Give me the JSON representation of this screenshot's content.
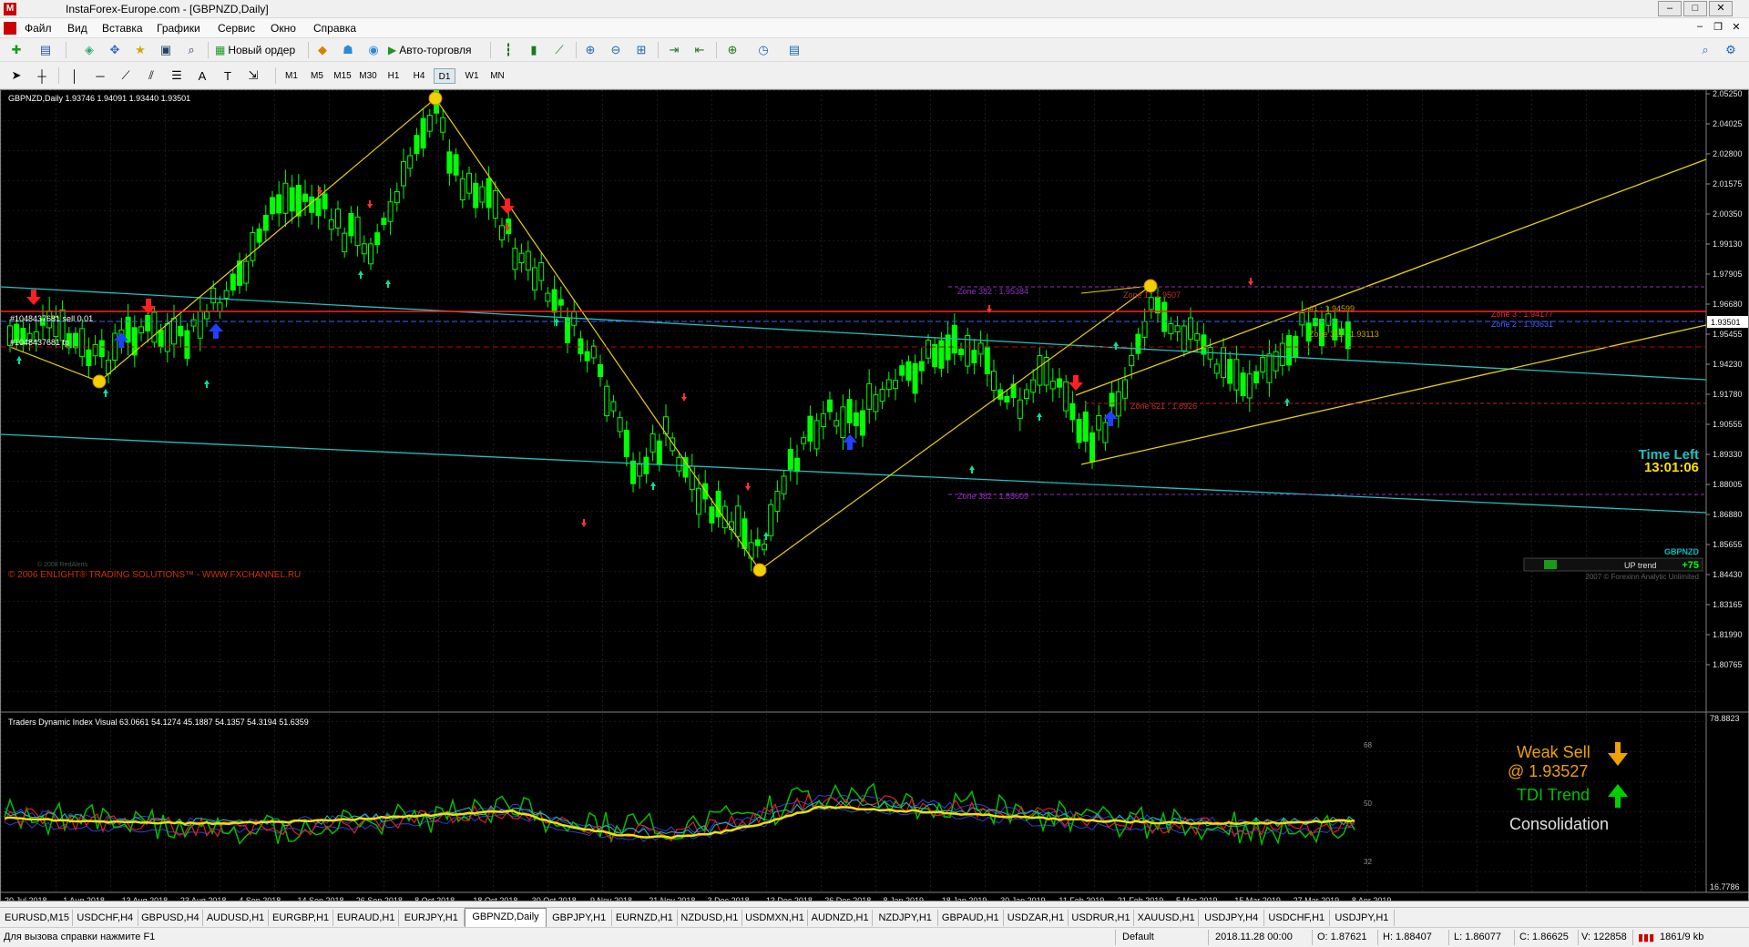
{
  "window": {
    "title": "InstaForex-Europe.com - [GBPNZD,Daily]",
    "app_icon": "metatrader-icon"
  },
  "menu": [
    "Файл",
    "Вид",
    "Вставка",
    "Графики",
    "Сервис",
    "Окно",
    "Справка"
  ],
  "toolbar": {
    "new_order": "Новый ордер",
    "auto_trading": "Авто-торговля"
  },
  "timeframes": [
    "M1",
    "M5",
    "M15",
    "M30",
    "H1",
    "H4",
    "D1",
    "W1",
    "MN"
  ],
  "active_timeframe": "D1",
  "chart": {
    "header": "GBPNZD,Daily  1.93746 1.94091 1.93440 1.93501",
    "price_scale": [
      "2.05250",
      "2.04025",
      "2.02800",
      "2.01575",
      "2.00350",
      "1.99130",
      "1.97905",
      "1.96680",
      "1.95455",
      "1.94230",
      "1.93501",
      "1.91780",
      "1.90555",
      "1.89330",
      "1.88005",
      "1.86880",
      "1.85655",
      "1.84430",
      "1.83165",
      "1.81990",
      "1.80765"
    ],
    "current_price": "1.93501",
    "date_scale": [
      "20 Jul 2018",
      "1 Aug 2018",
      "13 Aug 2018",
      "23 Aug 2018",
      "4 Sep 2018",
      "14 Sep 2018",
      "26 Sep 2018",
      "8 Oct 2018",
      "18 Oct 2018",
      "30 Oct 2018",
      "9 Nov 2018",
      "21 Nov 2018",
      "3 Dec 2018",
      "13 Dec 2018",
      "26 Dec 2018",
      "8 Jan 2019",
      "18 Jan 2019",
      "30 Jan 2019",
      "11 Feb 2019",
      "21 Feb 2019",
      "5 Mar 2019",
      "15 Mar 2019",
      "27 Mar 2019",
      "8 Apr 2019"
    ],
    "order_sell": "#1048437681 sell 0.01",
    "order_tp": "#1048437681 tp",
    "zone_labels": {
      "z1": "Zone 382 : 1.95384",
      "z2": "Zone 1 : 1.9507",
      "z3": "#1 : 1.94599",
      "z4": "Zone 3 : 1.94177",
      "z5": "Zone 2 : 1.93631",
      "z6": "Zone 311 : 1.93113",
      "z7": "Zone 621 : 1.8926",
      "z8": "Zone 382 : 1.85609"
    },
    "time_left_label": "Time Left",
    "time_left_value": "13:01:06",
    "symbol_badge": "GBPNZD",
    "up_trend_label": "UP trend",
    "up_trend_value": "+75",
    "copyright_left": "© 2006 ENLIGHT® TRADING SOLUTIONS™ - WWW.FXCHANNEL.RU",
    "copyright_small": "© 2008 RedAlerts",
    "copyright_right": "2007 © Forexinn Analytic Unlimited"
  },
  "indicator": {
    "header": "Traders Dynamic Index Visual 63.0661 54.1274 45.1887 54.1357 54.3194 51.6359",
    "scale_max": "78.8823",
    "scale_min": "16.7786",
    "levels": [
      "68",
      "50",
      "32"
    ],
    "weak_sell": "Weak Sell",
    "weak_sell_price": "@ 1.93527",
    "tdi_trend": "TDI Trend",
    "consolidation": "Consolidation"
  },
  "tabs": [
    "EURUSD,M15",
    "USDCHF,H4",
    "GBPUSD,H4",
    "AUDUSD,H1",
    "EURGBP,H1",
    "EURAUD,H1",
    "EURJPY,H1",
    "GBPNZD,Daily",
    "GBPJPY,H1",
    "EURNZD,H1",
    "NZDUSD,H1",
    "USDMXN,H1",
    "AUDNZD,H1",
    "NZDJPY,H1",
    "GBPAUD,H1",
    "USDZAR,H1",
    "USDRUR,H1",
    "XAUUSD,H1",
    "USDJPY,H4",
    "USDCHF,H1",
    "USDJPY,H1"
  ],
  "active_tab": "GBPNZD,Daily",
  "status": {
    "help": "Для вызова справки нажмите F1",
    "profile": "Default",
    "datetime": "2018.11.28 00:00",
    "open": "O: 1.87621",
    "high": "H: 1.88407",
    "low": "L: 1.86077",
    "close": "C: 1.86625",
    "volume": "V: 122858",
    "traffic": "1861/9 kb"
  },
  "colors": {
    "bull": "#00ff00",
    "bear": "#00ff00",
    "cyan_line": "#20c0c0",
    "yellow_line": "#e8d000",
    "resistance": "#ff2020",
    "support_blue": "#4060ff"
  }
}
